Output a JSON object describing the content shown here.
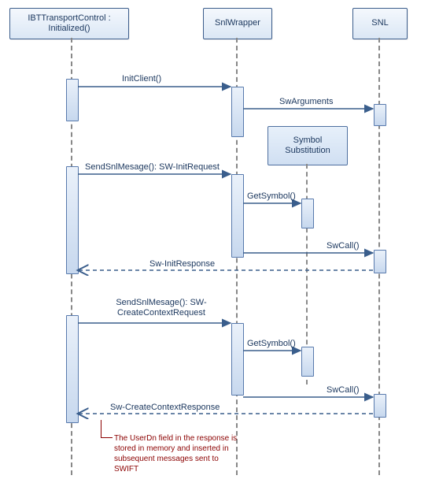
{
  "participants": {
    "ibt": "IBTTransportControl : Initialized()",
    "snlwrapper": "SnlWrapper",
    "snl": "SNL"
  },
  "objects": {
    "symbol_substitution": "Symbol\nSubstitution"
  },
  "messages": {
    "init_client": "InitClient()",
    "sw_arguments": "SwArguments",
    "send_init_req": "SendSnlMesage(): SW-InitRequest",
    "get_symbol_1": "GetSymbol()",
    "sw_call_1": "SwCall()",
    "sw_init_response": "Sw-InitResponse",
    "send_create_ctx_label": "SendSnlMesage():\nSW-CreateContextRequest",
    "get_symbol_2": "GetSymbol()",
    "sw_call_2": "SwCall()",
    "sw_create_ctx_response": "Sw-CreateContextResponse"
  },
  "annotation": "The UserDn field in the response is stored in memory and inserted in subsequent messages sent to SWIFT",
  "diagram": {
    "type": "sequence",
    "lifelines": [
      "IBTTransportControl : Initialized()",
      "SnlWrapper",
      "Symbol Substitution",
      "SNL"
    ],
    "sequence": [
      {
        "from": "IBT",
        "to": "SnlWrapper",
        "label": "InitClient()",
        "kind": "sync"
      },
      {
        "from": "SnlWrapper",
        "to": "SNL",
        "label": "SwArguments",
        "kind": "sync"
      },
      {
        "from": "IBT",
        "to": "SnlWrapper",
        "label": "SendSnlMesage(): SW-InitRequest",
        "kind": "sync"
      },
      {
        "from": "SnlWrapper",
        "to": "Symbol Substitution",
        "label": "GetSymbol()",
        "kind": "sync"
      },
      {
        "from": "SnlWrapper",
        "to": "SNL",
        "label": "SwCall()",
        "kind": "sync"
      },
      {
        "from": "SNL",
        "to": "IBT",
        "label": "Sw-InitResponse",
        "kind": "return"
      },
      {
        "from": "IBT",
        "to": "SnlWrapper",
        "label": "SendSnlMesage(): SW-CreateContextRequest",
        "kind": "sync"
      },
      {
        "from": "SnlWrapper",
        "to": "Symbol Substitution",
        "label": "GetSymbol()",
        "kind": "sync"
      },
      {
        "from": "SnlWrapper",
        "to": "SNL",
        "label": "SwCall()",
        "kind": "sync"
      },
      {
        "from": "SNL",
        "to": "IBT",
        "label": "Sw-CreateContextResponse",
        "kind": "return"
      }
    ]
  }
}
